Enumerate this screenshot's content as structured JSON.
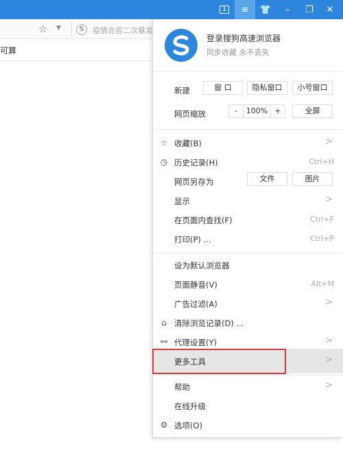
{
  "titlebar": {
    "tab_count": "1",
    "buttons": [
      "tab-count",
      "menu",
      "skin",
      "minimize",
      "restore",
      "close"
    ]
  },
  "toolbar": {
    "search_placeholder": "疫情会否二次暴发"
  },
  "bookmarks": {
    "partial_text": "可算"
  },
  "menu": {
    "login_title": "登录搜狗高速浏览器",
    "login_sub": "同步收藏 永不丢失",
    "new_label": "新建",
    "new_window": "窗 口",
    "new_private": "隐私窗口",
    "new_small": "小号窗口",
    "zoom_label": "网页缩放",
    "zoom_minus": "-",
    "zoom_value": "100%",
    "zoom_plus": "+",
    "fullscreen": "全屏",
    "favorites": "收藏(B)",
    "history": "历史记录(H)",
    "history_sc": "Ctrl+H",
    "save_as": "网页另存为",
    "save_file": "文件",
    "save_image": "图片",
    "display": "显示",
    "find": "在页面内查找(F)",
    "find_sc": "Ctrl+F",
    "print": "打印(P) ...",
    "print_sc": "Ctrl+P",
    "default_browser": "设为默认浏览器",
    "mute": "页面静音(V)",
    "mute_sc": "Alt+M",
    "adblock": "广告过滤(A)",
    "clear_history": "清除浏览记录(D) ...",
    "proxy": "代理设置(Y)",
    "more_tools": "更多工具",
    "help": "帮助",
    "upgrade": "在线升级",
    "options": "选项(O)",
    "arrow": ">"
  },
  "colors": {
    "titlebar": "#2e86dc",
    "highlight": "#e6e6e6",
    "annotation": "#d9373e"
  }
}
